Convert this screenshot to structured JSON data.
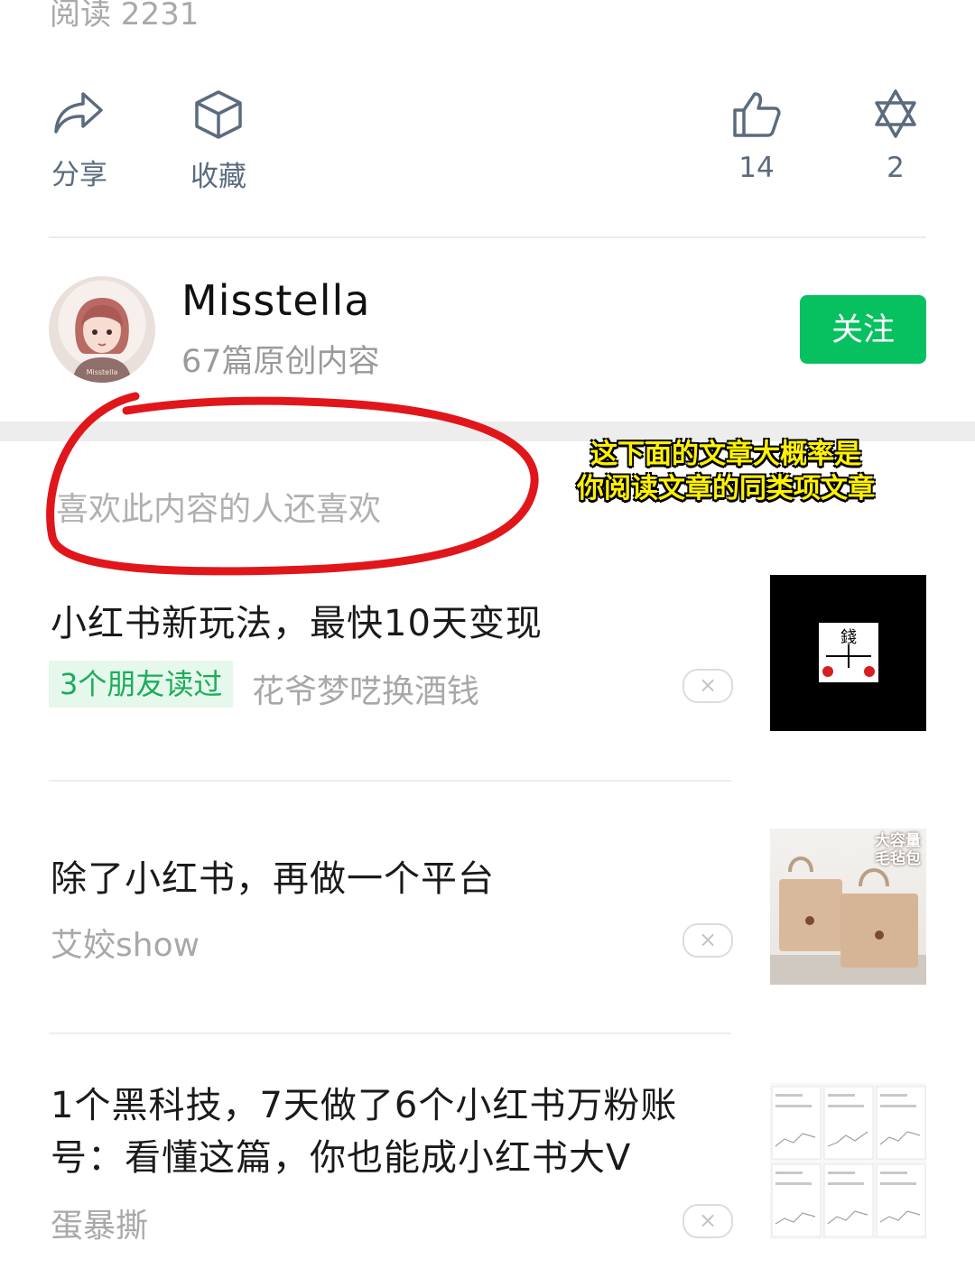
{
  "stats": {
    "read_count": "阅读 2231"
  },
  "actions": {
    "share_label": "分享",
    "favorite_label": "收藏",
    "like_count": "14",
    "wow_count": "2"
  },
  "author": {
    "name": "Misstella",
    "subtitle": "67篇原创内容",
    "follow_label": "关注",
    "avatar_signature": "Misstella"
  },
  "recommend": {
    "section_title": "喜欢此内容的人还喜欢",
    "annotation_line1": "这下面的文章大概率是",
    "annotation_line2": "你阅读文章的同类项文章",
    "articles": [
      {
        "title": "小红书新玩法，最快10天变现",
        "friend_tag": "3个朋友读过",
        "source": "花爷梦呓换酒钱",
        "thumb_text": "錢"
      },
      {
        "title": "除了小红书，再做一个平台",
        "source": "艾姣show",
        "thumb_text_line1": "大容量",
        "thumb_text_line2": "毛毡包"
      },
      {
        "title_line1": "1个黑科技，7天做了6个小红书万粉账",
        "title_line2": "号：看懂这篇，你也能成小红书大V",
        "source": "蛋暴撕"
      }
    ],
    "dismiss_symbol": "×"
  },
  "colors": {
    "accent_green": "#07c160",
    "annotation_yellow": "#fff200",
    "circle_red": "#e0161b"
  }
}
